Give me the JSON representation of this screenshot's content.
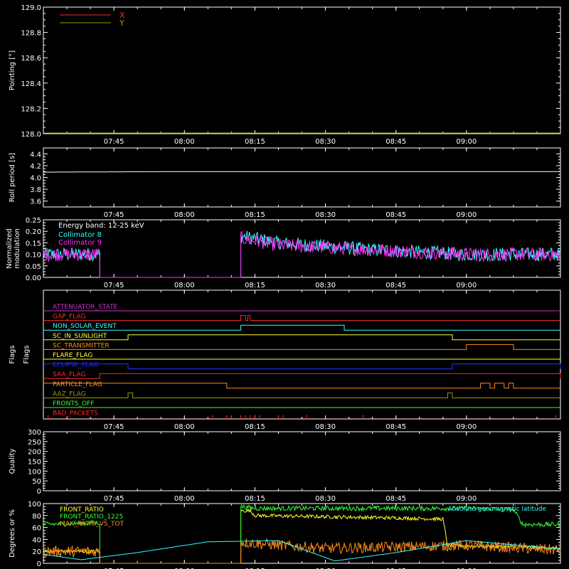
{
  "colors": {
    "background": "#000000",
    "foreground": "#ffffff",
    "red": "#ff2a2a",
    "olive": "#9a9a00",
    "cyan": "#33ffff",
    "magenta": "#ff33ff",
    "yellow": "#ffff33",
    "orange": "#ff8c1a",
    "green": "#33ff33",
    "blue": "#2233ff",
    "purple": "#cc33cc"
  },
  "time_axis": {
    "range": [
      "07:30",
      "09:20"
    ],
    "ticks": [
      "07:45",
      "08:00",
      "08:15",
      "08:30",
      "08:45",
      "09:00"
    ]
  },
  "chart_data": [
    {
      "type": "line",
      "ylabel": "Pointing [°]",
      "ylim": [
        128.0,
        129.0
      ],
      "yticks": [
        "128.0",
        "128.2",
        "128.4",
        "128.6",
        "128.8",
        "129.0"
      ],
      "legend_position": "top-left",
      "series": [
        {
          "name": "X",
          "color": "#ff2a2a",
          "values": []
        },
        {
          "name": "Y",
          "color": "#9a9a00",
          "values": []
        }
      ]
    },
    {
      "type": "line",
      "ylabel": "Roll period [s]",
      "ylim": [
        3.5,
        4.5
      ],
      "yticks": [
        "3.6",
        "3.8",
        "4.0",
        "4.2",
        "4.4"
      ],
      "series": [
        {
          "color": "#ffffff",
          "x": [
            "07:30",
            "08:00",
            "08:20",
            "08:45",
            "09:00",
            "09:20"
          ],
          "y": [
            4.09,
            4.1,
            4.1,
            4.1,
            4.1,
            4.1
          ]
        }
      ]
    },
    {
      "type": "line",
      "ylabel": "Normalized modulation",
      "ylim": [
        0,
        0.25
      ],
      "yticks": [
        "0.00",
        "0.05",
        "0.10",
        "0.15",
        "0.20",
        "0.25"
      ],
      "annotation": "Energy band: 12-25 keV",
      "legend_position": "top-left",
      "series": [
        {
          "name": "Collimator 8",
          "color": "#33ffff",
          "x": [
            "07:30",
            "07:42",
            "07:42",
            "07:45",
            "07:45",
            "08:12",
            "08:12",
            "08:20",
            "08:40",
            "09:00",
            "09:20"
          ],
          "y": [
            0.1,
            0.1,
            0.0,
            0.0,
            0.0,
            0.0,
            0.18,
            0.15,
            0.12,
            0.1,
            0.1
          ]
        },
        {
          "name": "Collimator 9",
          "color": "#ff33ff",
          "x": [
            "07:30",
            "07:42",
            "07:42",
            "08:12",
            "08:12",
            "08:20",
            "08:40",
            "09:00",
            "09:20"
          ],
          "y": [
            0.1,
            0.1,
            0.0,
            0.0,
            0.17,
            0.14,
            0.12,
            0.1,
            0.1
          ]
        }
      ]
    },
    {
      "type": "line",
      "ylabel": "Flags",
      "flags": [
        {
          "name": "ATTENUATOR_STATE",
          "color": "#cc33cc",
          "high": []
        },
        {
          "name": "GAP_FLAG",
          "color": "#ff2a2a",
          "high": [
            [
              "08:12",
              "08:13"
            ],
            [
              "08:13.5",
              "08:14"
            ]
          ]
        },
        {
          "name": "NON_SOLAR_EVENT",
          "color": "#33ffff",
          "high": [
            [
              "08:12",
              "08:34"
            ]
          ]
        },
        {
          "name": "SC_IN_SUNLIGHT",
          "color": "#ffff33",
          "high": [
            [
              "07:48",
              "08:57"
            ]
          ]
        },
        {
          "name": "SC_TRANSMITTER",
          "color": "#ff8c1a",
          "high": [
            [
              "09:00",
              "09:10"
            ]
          ]
        },
        {
          "name": "FLARE_FLAG",
          "color": "#ffff33",
          "high": []
        },
        {
          "name": "ECLIPSE_FLAG",
          "color": "#2233ff",
          "high": [
            [
              "07:30",
              "07:48"
            ],
            [
              "08:57",
              "09:20"
            ]
          ]
        },
        {
          "name": "SAA_FLAG",
          "color": "#ff2a2a",
          "high": [
            [
              "07:42",
              "09:20"
            ]
          ]
        },
        {
          "name": "PARTICLE_FLAG",
          "color": "#ff8c1a",
          "high": [
            [
              "07:30",
              "08:09"
            ],
            [
              "09:03",
              "09:05"
            ],
            [
              "09:06",
              "09:08"
            ],
            [
              "09:09",
              "09:10"
            ]
          ]
        },
        {
          "name": "AAZ_FLAG",
          "color": "#9a9a00",
          "high": [
            [
              "07:48",
              "07:49"
            ],
            [
              "08:56",
              "08:57"
            ]
          ]
        },
        {
          "name": "FRONTS_OFF",
          "color": "#33ff33",
          "high": []
        },
        {
          "name": "BAD_PACKETS",
          "color": "#ff2a2a",
          "events": [
            "07:31",
            "08:06",
            "08:09",
            "08:10",
            "08:12",
            "08:13",
            "08:14",
            "08:15",
            "08:16",
            "08:20",
            "08:21",
            "08:26",
            "08:38",
            "09:19"
          ]
        }
      ]
    },
    {
      "type": "line",
      "ylabel": "Quality",
      "ylim": [
        0,
        300
      ],
      "yticks": [
        "0",
        "50",
        "100",
        "150",
        "200",
        "250",
        "300"
      ],
      "series": []
    },
    {
      "type": "line",
      "ylabel": "Degrees or %",
      "ylim": [
        0,
        100
      ],
      "yticks": [
        "0",
        "20",
        "40",
        "60",
        "80",
        "100"
      ],
      "legend_position": "top-left",
      "annotation": "Absolute geomagnetic latitude",
      "series": [
        {
          "name": "FRONT_RATIO",
          "color": "#ffff33",
          "x": [
            "07:30",
            "07:42",
            "07:42",
            "08:12",
            "08:12",
            "08:14",
            "08:15",
            "08:30",
            "08:45",
            "08:55",
            "08:56",
            "09:20"
          ],
          "y": [
            20,
            20,
            0,
            0,
            88,
            88,
            80,
            78,
            76,
            74,
            30,
            25
          ]
        },
        {
          "name": "FRONT_RATIO_1225",
          "color": "#33ff33",
          "x": [
            "07:30",
            "07:42",
            "07:42",
            "08:12",
            "08:12",
            "08:15",
            "08:30",
            "08:45",
            "09:00",
            "09:10",
            "09:12",
            "09:20"
          ],
          "y": [
            65,
            68,
            0,
            0,
            95,
            92,
            92,
            92,
            92,
            90,
            65,
            65
          ]
        },
        {
          "name": "MAX_RATIO_VS_TOT",
          "color": "#ff8c1a",
          "x": [
            "07:30",
            "07:42",
            "07:42",
            "08:12",
            "08:12",
            "08:30",
            "09:00",
            "09:20"
          ],
          "y": [
            20,
            20,
            0,
            0,
            35,
            25,
            30,
            22
          ]
        },
        {
          "name": "Absolute geomagnetic latitude",
          "color": "#33ffff",
          "x": [
            "07:30",
            "07:38",
            "07:50",
            "08:05",
            "08:20",
            "08:32",
            "08:45",
            "09:00",
            "09:20"
          ],
          "y": [
            15,
            6,
            18,
            36,
            38,
            4,
            18,
            38,
            24
          ]
        }
      ]
    }
  ]
}
